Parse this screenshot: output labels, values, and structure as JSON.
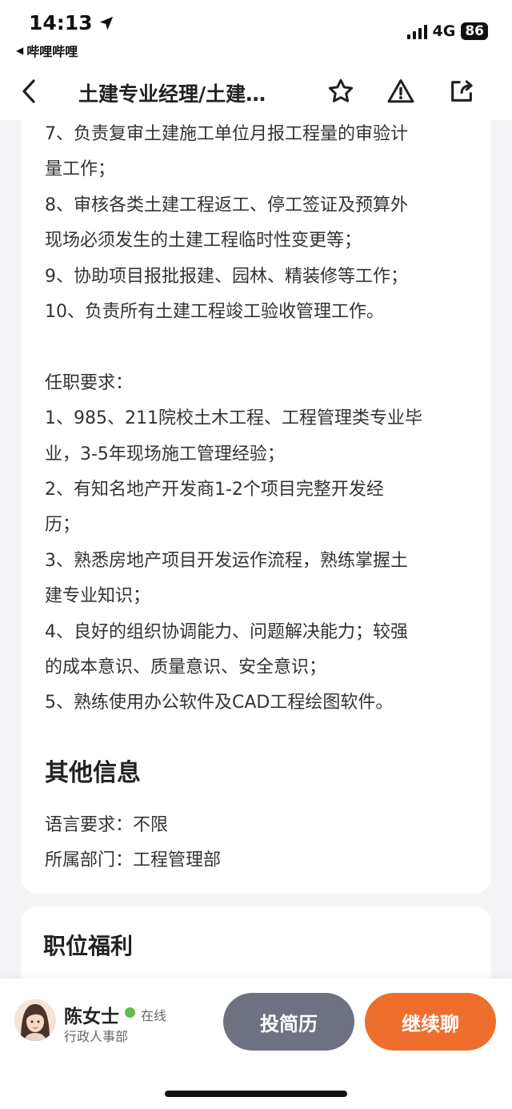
{
  "status": {
    "time": "14:13",
    "back_app": "哔哩哔哩",
    "network": "4G",
    "battery": "86"
  },
  "nav": {
    "title": "土建专业经理/土建…"
  },
  "job": {
    "description_lines": [
      "7、负责复审土建施工单位月报工程量的审验计",
      "量工作；",
      "8、审核各类土建工程返工、停工签证及预算外",
      "现场必须发生的土建工程临时性变更等；",
      "9、协助项目报批报建、园林、精装修等工作；",
      "10、负责所有土建工程竣工验收管理工作。",
      "",
      "任职要求：",
      "1、985、211院校土木工程、工程管理类专业毕",
      "业，3-5年现场施工管理经验；",
      "2、有知名地产开发商1-2个项目完整开发经",
      "历；",
      "3、熟悉房地产项目开发运作流程，熟练掌握土",
      "建专业知识；",
      "4、良好的组织协调能力、问题解决能力；较强",
      "的成本意识、质量意识、安全意识；",
      "5、熟练使用办公软件及CAD工程绘图软件。"
    ],
    "other_info": {
      "title": "其他信息",
      "language": "语言要求：不限",
      "department": "所属部门：工程管理部"
    },
    "benefits_title": "职位福利"
  },
  "recruiter": {
    "name": "陈女士",
    "status": "在线",
    "department": "行政人事部"
  },
  "actions": {
    "resume_label": "投简历",
    "chat_label": "继续聊"
  },
  "colors": {
    "primary_orange": "#ee6f2d",
    "secondary_gray": "#6e7280",
    "online_green": "#5ec04b"
  }
}
